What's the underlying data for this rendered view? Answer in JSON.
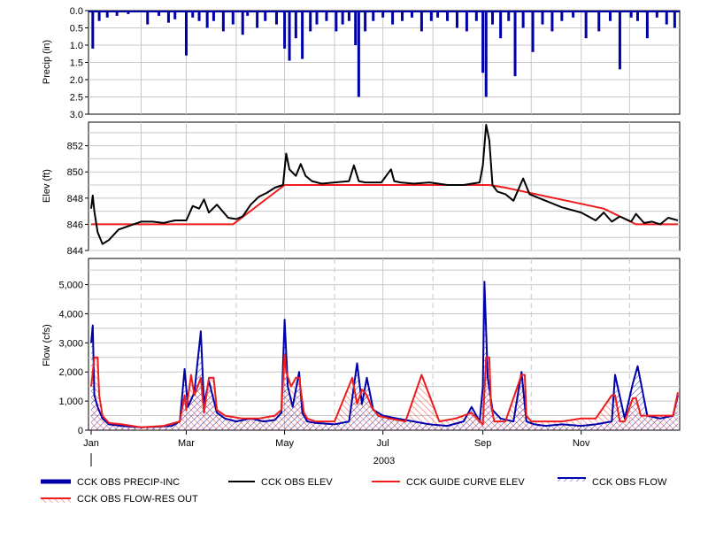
{
  "chart_data": [
    {
      "type": "bar",
      "panel": "precip",
      "ylabel": "Precip (in)",
      "ylim": [
        0,
        3
      ],
      "y_inverted": true,
      "yticks": [
        "0.0",
        "0.5",
        "1.0",
        "1.5",
        "2.0",
        "2.5",
        "3.0"
      ],
      "x": [
        "2003-01-02",
        "2003-01-06",
        "2003-01-11",
        "2003-01-17",
        "2003-01-24",
        "2003-02-05",
        "2003-02-12",
        "2003-02-18",
        "2003-02-22",
        "2003-03-01",
        "2003-03-05",
        "2003-03-09",
        "2003-03-14",
        "2003-03-18",
        "2003-03-24",
        "2003-03-30",
        "2003-04-05",
        "2003-04-08",
        "2003-04-14",
        "2003-04-19",
        "2003-04-26",
        "2003-05-01",
        "2003-05-04",
        "2003-05-08",
        "2003-05-12",
        "2003-05-17",
        "2003-05-21",
        "2003-05-27",
        "2003-06-02",
        "2003-06-06",
        "2003-06-10",
        "2003-06-14",
        "2003-06-16",
        "2003-06-20",
        "2003-06-25",
        "2003-07-01",
        "2003-07-07",
        "2003-07-13",
        "2003-07-19",
        "2003-07-25",
        "2003-07-31",
        "2003-08-04",
        "2003-08-10",
        "2003-08-16",
        "2003-08-22",
        "2003-08-28",
        "2003-09-01",
        "2003-09-03",
        "2003-09-07",
        "2003-09-12",
        "2003-09-17",
        "2003-09-21",
        "2003-09-26",
        "2003-10-02",
        "2003-10-08",
        "2003-10-14",
        "2003-10-20",
        "2003-10-27",
        "2003-11-04",
        "2003-11-12",
        "2003-11-19",
        "2003-11-25",
        "2003-12-02",
        "2003-12-06",
        "2003-12-12",
        "2003-12-18",
        "2003-12-24",
        "2003-12-29"
      ],
      "values": [
        1.1,
        0.3,
        0.2,
        0.15,
        0.1,
        0.4,
        0.15,
        0.35,
        0.25,
        1.3,
        0.2,
        0.3,
        0.5,
        0.3,
        0.6,
        0.4,
        0.7,
        0.15,
        0.5,
        0.3,
        0.4,
        1.1,
        1.45,
        0.8,
        1.4,
        0.6,
        0.4,
        0.3,
        0.6,
        0.4,
        0.3,
        1.0,
        2.5,
        0.6,
        0.3,
        0.2,
        0.4,
        0.3,
        0.2,
        0.6,
        0.3,
        0.2,
        0.3,
        0.5,
        0.6,
        0.3,
        1.8,
        2.5,
        0.4,
        0.8,
        0.3,
        1.9,
        0.5,
        1.2,
        0.4,
        0.6,
        0.3,
        0.2,
        0.8,
        0.6,
        0.3,
        1.7,
        0.2,
        0.3,
        0.8,
        0.2,
        0.4,
        0.5
      ],
      "series_name": "CCK OBS PRECIP-INC",
      "color": "#0000a8"
    },
    {
      "type": "line",
      "panel": "elevation",
      "ylabel": "Elev (ft)",
      "ylim": [
        844,
        853.8
      ],
      "yticks": [
        "844",
        "846",
        "848",
        "850",
        "852"
      ],
      "series": [
        {
          "name": "CCK OBS ELEV",
          "color": "#000000",
          "x": [
            "2003-01-01",
            "2003-01-02",
            "2003-01-03",
            "2003-01-05",
            "2003-01-08",
            "2003-01-12",
            "2003-01-18",
            "2003-01-25",
            "2003-02-01",
            "2003-02-08",
            "2003-02-15",
            "2003-02-22",
            "2003-03-01",
            "2003-03-05",
            "2003-03-09",
            "2003-03-12",
            "2003-03-15",
            "2003-03-20",
            "2003-03-27",
            "2003-04-01",
            "2003-04-05",
            "2003-04-10",
            "2003-04-15",
            "2003-04-20",
            "2003-04-25",
            "2003-04-30",
            "2003-05-02",
            "2003-05-04",
            "2003-05-08",
            "2003-05-11",
            "2003-05-14",
            "2003-05-18",
            "2003-05-24",
            "2003-06-01",
            "2003-06-10",
            "2003-06-13",
            "2003-06-16",
            "2003-06-20",
            "2003-06-30",
            "2003-07-06",
            "2003-07-08",
            "2003-07-12",
            "2003-07-20",
            "2003-07-30",
            "2003-08-10",
            "2003-08-20",
            "2003-08-30",
            "2003-09-01",
            "2003-09-03",
            "2003-09-05",
            "2003-09-07",
            "2003-09-10",
            "2003-09-15",
            "2003-09-20",
            "2003-09-26",
            "2003-09-30",
            "2003-10-10",
            "2003-10-20",
            "2003-11-01",
            "2003-11-10",
            "2003-11-15",
            "2003-11-20",
            "2003-11-25",
            "2003-12-02",
            "2003-12-05",
            "2003-12-10",
            "2003-12-15",
            "2003-12-20",
            "2003-12-25",
            "2003-12-31"
          ],
          "values": [
            847.2,
            848.2,
            847.0,
            845.4,
            844.5,
            844.8,
            845.6,
            845.9,
            846.2,
            846.2,
            846.1,
            846.3,
            846.3,
            847.4,
            847.2,
            847.9,
            846.9,
            847.5,
            846.5,
            846.4,
            846.6,
            847.5,
            848.1,
            848.4,
            848.8,
            849.0,
            851.4,
            850.2,
            849.7,
            850.6,
            849.7,
            849.3,
            849.1,
            849.2,
            849.3,
            850.5,
            849.3,
            849.2,
            849.2,
            850.2,
            849.3,
            849.2,
            849.1,
            849.2,
            849.0,
            849.0,
            849.2,
            850.5,
            853.6,
            852.4,
            849.0,
            848.5,
            848.3,
            847.8,
            849.5,
            848.3,
            847.8,
            847.3,
            846.9,
            846.3,
            846.9,
            846.2,
            846.6,
            846.2,
            846.8,
            846.1,
            846.2,
            846.0,
            846.5,
            846.3
          ]
        },
        {
          "name": "CCK GUIDE CURVE ELEV",
          "color": "#ee1c1c",
          "x": [
            "2003-01-01",
            "2003-01-15",
            "2003-03-30",
            "2003-05-01",
            "2003-09-05",
            "2003-09-15",
            "2003-11-15",
            "2003-12-05",
            "2003-12-31"
          ],
          "values": [
            846.0,
            846.0,
            846.0,
            849.0,
            849.0,
            848.8,
            847.2,
            846.0,
            846.0
          ]
        }
      ]
    },
    {
      "type": "line",
      "panel": "flow",
      "ylabel": "Flow (cfs)",
      "ylim": [
        0,
        5900
      ],
      "yticks": [
        "0",
        "1,000",
        "2,000",
        "3,000",
        "4,000",
        "5,000"
      ],
      "xlabel": "2003",
      "xticks": [
        "Jan",
        "Mar",
        "May",
        "Jul",
        "Sep",
        "Nov"
      ],
      "series": [
        {
          "name": "CCK OBS FLOW",
          "color": "#0000a8",
          "x": [
            "2003-01-01",
            "2003-01-02",
            "2003-01-03",
            "2003-01-05",
            "2003-01-08",
            "2003-01-12",
            "2003-01-20",
            "2003-02-01",
            "2003-02-10",
            "2003-02-20",
            "2003-02-25",
            "2003-02-28",
            "2003-03-02",
            "2003-03-06",
            "2003-03-10",
            "2003-03-12",
            "2003-03-15",
            "2003-03-20",
            "2003-03-25",
            "2003-04-01",
            "2003-04-10",
            "2003-04-18",
            "2003-04-25",
            "2003-04-29",
            "2003-05-01",
            "2003-05-03",
            "2003-05-06",
            "2003-05-10",
            "2003-05-12",
            "2003-05-15",
            "2003-05-20",
            "2003-06-01",
            "2003-06-10",
            "2003-06-15",
            "2003-06-18",
            "2003-06-21",
            "2003-06-25",
            "2003-07-01",
            "2003-07-10",
            "2003-07-20",
            "2003-07-30",
            "2003-08-10",
            "2003-08-20",
            "2003-08-25",
            "2003-08-30",
            "2003-09-01",
            "2003-09-02",
            "2003-09-04",
            "2003-09-07",
            "2003-09-12",
            "2003-09-20",
            "2003-09-25",
            "2003-09-28",
            "2003-10-03",
            "2003-10-10",
            "2003-10-20",
            "2003-11-01",
            "2003-11-10",
            "2003-11-20",
            "2003-11-22",
            "2003-11-28",
            "2003-12-03",
            "2003-12-06",
            "2003-12-12",
            "2003-12-20",
            "2003-12-28",
            "2003-12-31"
          ],
          "values": [
            3000,
            3600,
            1200,
            800,
            400,
            200,
            150,
            100,
            120,
            150,
            300,
            2100,
            800,
            1300,
            3400,
            900,
            1700,
            600,
            400,
            300,
            400,
            300,
            350,
            600,
            3800,
            1500,
            800,
            2000,
            600,
            300,
            250,
            200,
            300,
            2300,
            900,
            1800,
            700,
            500,
            400,
            300,
            200,
            150,
            300,
            800,
            300,
            1500,
            5100,
            1800,
            700,
            400,
            300,
            2000,
            300,
            200,
            150,
            200,
            150,
            200,
            300,
            1900,
            400,
            1600,
            2200,
            500,
            400,
            500,
            1200
          ]
        },
        {
          "name": "CCK OBS FLOW-RES OUT",
          "color": "#ee1c1c",
          "x": [
            "2003-01-01",
            "2003-01-03",
            "2003-01-05",
            "2003-01-06",
            "2003-01-08",
            "2003-01-12",
            "2003-01-20",
            "2003-02-01",
            "2003-02-15",
            "2003-02-25",
            "2003-02-28",
            "2003-03-01",
            "2003-03-04",
            "2003-03-06",
            "2003-03-10",
            "2003-03-12",
            "2003-03-15",
            "2003-03-18",
            "2003-03-20",
            "2003-03-25",
            "2003-04-05",
            "2003-04-15",
            "2003-04-25",
            "2003-04-29",
            "2003-05-01",
            "2003-05-02",
            "2003-05-05",
            "2003-05-08",
            "2003-05-10",
            "2003-05-13",
            "2003-05-15",
            "2003-05-20",
            "2003-06-01",
            "2003-06-12",
            "2003-06-15",
            "2003-06-18",
            "2003-06-21",
            "2003-06-24",
            "2003-06-28",
            "2003-07-05",
            "2003-07-15",
            "2003-07-25",
            "2003-08-05",
            "2003-08-15",
            "2003-08-25",
            "2003-09-01",
            "2003-09-03",
            "2003-09-05",
            "2003-09-06",
            "2003-09-08",
            "2003-09-15",
            "2003-09-25",
            "2003-09-27",
            "2003-09-28",
            "2003-10-01",
            "2003-10-10",
            "2003-10-20",
            "2003-11-01",
            "2003-11-10",
            "2003-11-20",
            "2003-11-22",
            "2003-11-25",
            "2003-11-28",
            "2003-12-03",
            "2003-12-05",
            "2003-12-08",
            "2003-12-12",
            "2003-12-20",
            "2003-12-28",
            "2003-12-31"
          ],
          "values": [
            1500,
            2500,
            2500,
            1200,
            500,
            250,
            200,
            100,
            150,
            300,
            1200,
            700,
            1900,
            1200,
            1800,
            600,
            1800,
            1800,
            700,
            500,
            400,
            400,
            500,
            700,
            2600,
            2000,
            1500,
            1800,
            1800,
            600,
            400,
            300,
            300,
            1800,
            900,
            1400,
            1200,
            800,
            500,
            400,
            300,
            1900,
            300,
            400,
            600,
            200,
            2500,
            2500,
            900,
            300,
            300,
            1900,
            1900,
            500,
            300,
            300,
            300,
            400,
            400,
            1200,
            1200,
            300,
            300,
            1100,
            1100,
            500,
            500,
            500,
            500,
            1300
          ]
        }
      ]
    }
  ],
  "legend": [
    {
      "label": "CCK OBS PRECIP-INC",
      "style": "thick-bar",
      "color": "#0000a8"
    },
    {
      "label": "CCK OBS ELEV",
      "style": "line",
      "color": "#000000"
    },
    {
      "label": "CCK GUIDE CURVE ELEV",
      "style": "line",
      "color": "#ee1c1c"
    },
    {
      "label": "CCK OBS FLOW",
      "style": "hatch-line",
      "color": "#0000a8"
    },
    {
      "label": "CCK OBS FLOW-RES OUT",
      "style": "hatch-line",
      "color": "#ee1c1c"
    }
  ]
}
